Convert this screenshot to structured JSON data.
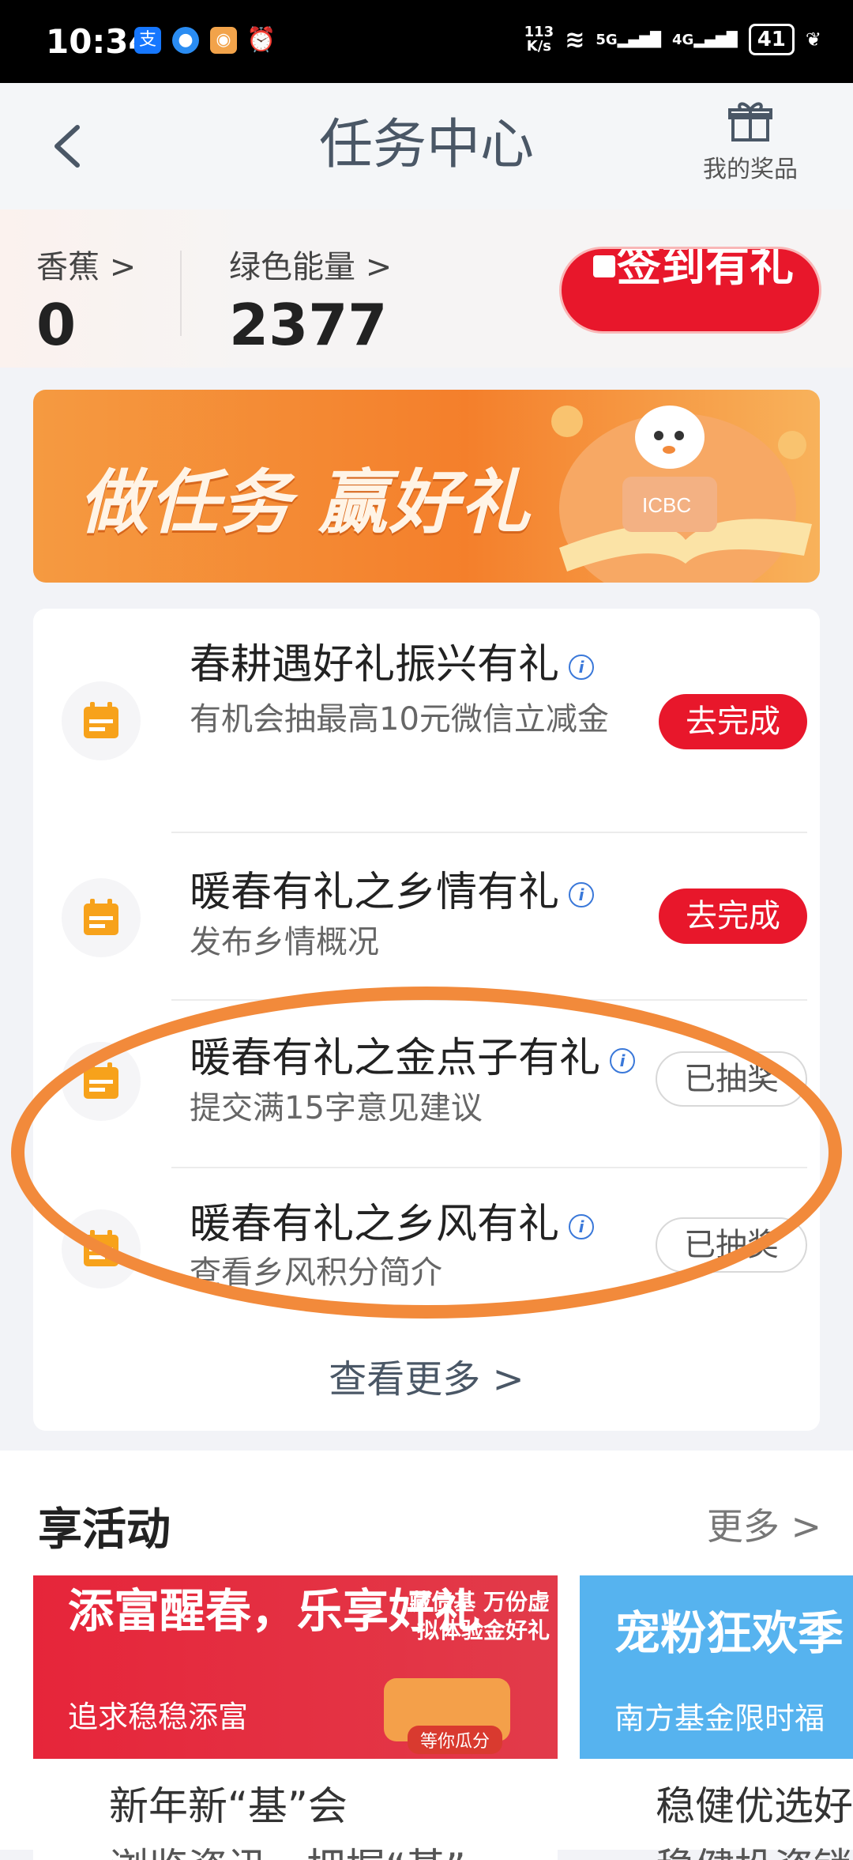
{
  "status_bar": {
    "time": "10:34",
    "net_speed_value": "113",
    "net_speed_unit": "K/s",
    "net5g": "5G",
    "net4g": "4G",
    "battery": "41"
  },
  "header": {
    "title": "任务中心",
    "prizes_label": "我的奖品"
  },
  "stats": {
    "banana_label": "香蕉 >",
    "banana_value": "0",
    "energy_label": "绿色能量 >",
    "energy_value": "2377",
    "checkin_label": "签到有礼"
  },
  "banner": {
    "text": "做任务 赢好礼",
    "logo_text": "ICBC"
  },
  "tasks": [
    {
      "title": "春耕遇好礼振兴有礼",
      "desc": "有机会抽最高10元微信立减金",
      "action": "去完成"
    },
    {
      "title": "暖春有礼之乡情有礼",
      "desc": "发布乡情概况",
      "action": "去完成"
    },
    {
      "title": "暖春有礼之金点子有礼",
      "desc": "提交满15字意见建议",
      "action": "已抽奖"
    },
    {
      "title": "暖春有礼之乡风有礼",
      "desc": "查看乡风积分简介",
      "action": "已抽奖"
    }
  ],
  "view_more": "查看更多 >",
  "activities": {
    "title": "享活动",
    "more": "更多 >",
    "cards": [
      {
        "headline": "添富醒春，乐享好礼",
        "subtitle": "追求稳稳添富",
        "overlay": "藏债基 万份虚拟体验金好礼",
        "tag": "等你瓜分",
        "line1": "新年新“基”会",
        "line2": "浏览资讯，把握“基”"
      },
      {
        "headline": "宠粉狂欢季",
        "subtitle": "南方基金限时福",
        "line1": "稳健优选好",
        "line2": "稳健投资锁"
      }
    ]
  },
  "colors": {
    "primary_red": "#e8172b",
    "title_gray": "#4a5766",
    "highlight_orange": "#f28a3b"
  }
}
